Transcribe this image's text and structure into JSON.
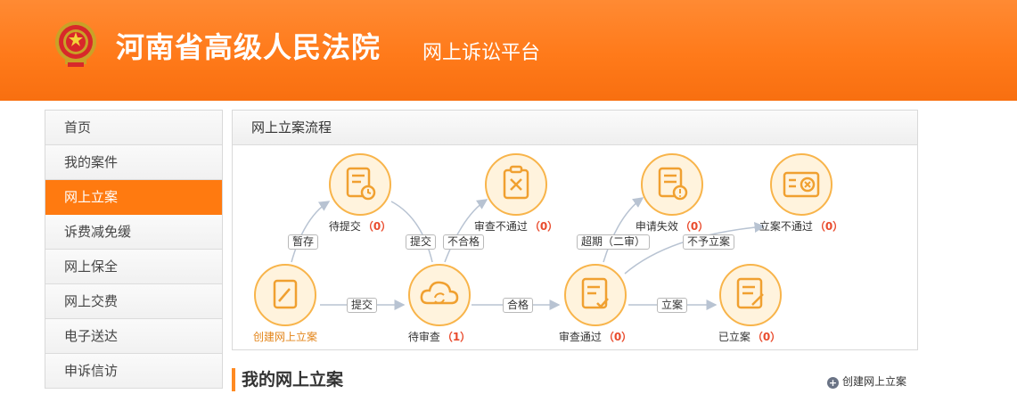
{
  "header": {
    "title": "河南省高级人民法院",
    "subtitle": "网上诉讼平台",
    "emblem_icon": "court-emblem-icon"
  },
  "sidebar": {
    "items": [
      {
        "label": "首页",
        "active": false
      },
      {
        "label": "我的案件",
        "active": false
      },
      {
        "label": "网上立案",
        "active": true
      },
      {
        "label": "诉费减免缓",
        "active": false
      },
      {
        "label": "网上保全",
        "active": false
      },
      {
        "label": "网上交费",
        "active": false
      },
      {
        "label": "电子送达",
        "active": false
      },
      {
        "label": "申诉信访",
        "active": false
      }
    ]
  },
  "flow": {
    "title": "网上立案流程",
    "nodes": {
      "create": {
        "label": "创建网上立案",
        "icon": "edit-document-icon"
      },
      "pending_submit": {
        "label": "待提交",
        "count": "（0）",
        "icon": "document-clock-icon"
      },
      "review_failed": {
        "label": "审查不通过",
        "count": "（0）",
        "icon": "clipboard-x-icon"
      },
      "apply_invalid": {
        "label": "申请失效",
        "count": "（0）",
        "icon": "document-warning-icon"
      },
      "filing_rejected": {
        "label": "立案不通过",
        "count": "（0）",
        "icon": "card-x-icon"
      },
      "pending_review": {
        "label": "待审查",
        "count": "（1）",
        "icon": "cloud-sync-icon"
      },
      "review_passed": {
        "label": "审查通过",
        "count": "（0）",
        "icon": "document-check-icon"
      },
      "filed": {
        "label": "已立案",
        "count": "（0）",
        "icon": "document-pen-icon"
      }
    },
    "edges": {
      "save": "暂存",
      "submit_top": "提交",
      "unqualified": "不合格",
      "overdue": "超期（二审）",
      "not_filed": "不予立案",
      "submit_bottom": "提交",
      "qualified": "合格",
      "file": "立案"
    },
    "colors": {
      "accent": "#ff7a10",
      "node_fill": "#fff3dd",
      "node_border": "#f8b44a",
      "count": "#e94b2d"
    }
  },
  "main": {
    "section_title": "我的网上立案",
    "create_link": "创建网上立案",
    "create_icon": "plus-circle-icon"
  }
}
